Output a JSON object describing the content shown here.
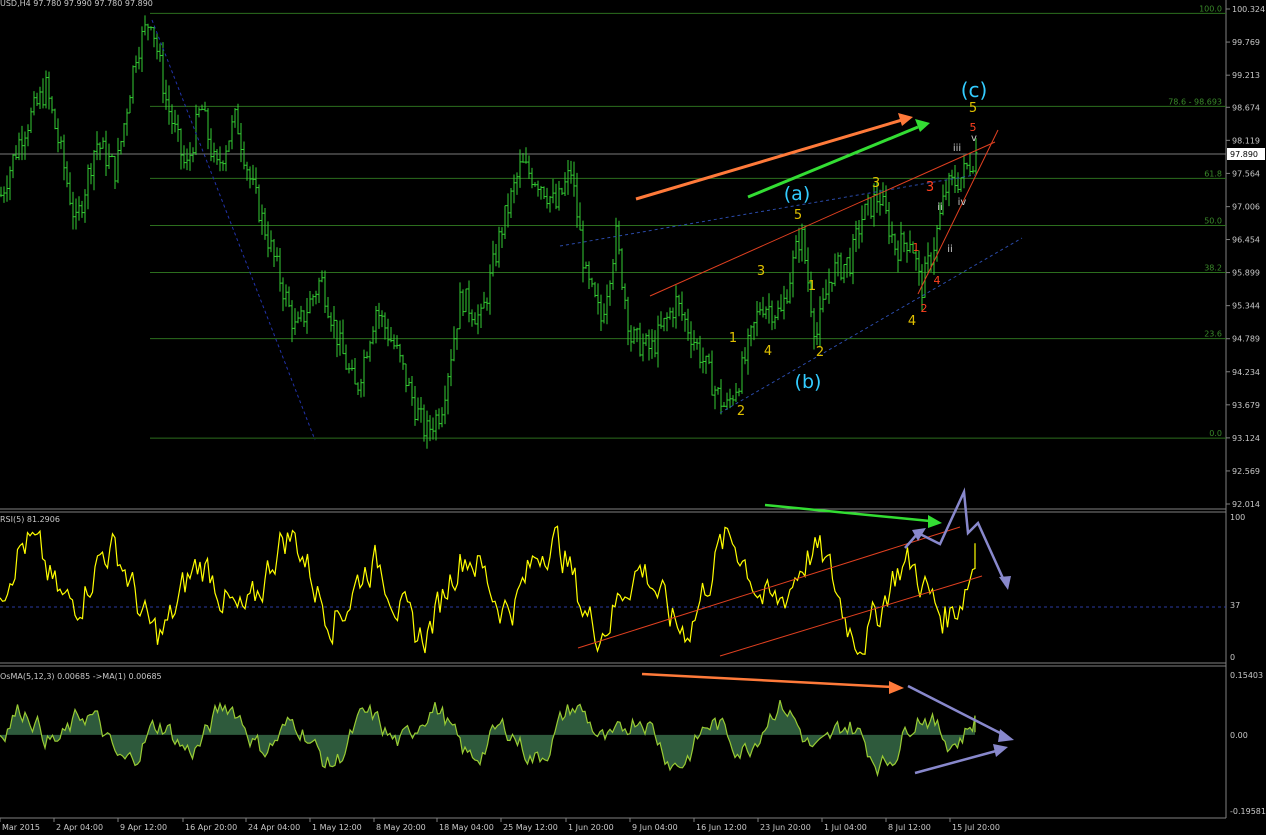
{
  "header": {
    "symbol_info": "USD,H4  97.780 97.990 97.780 97.890"
  },
  "chart_data": [
    {
      "type": "ohlc",
      "panel": "main",
      "title": "USD,H4  97.780 97.990 97.780 97.890",
      "bar_color": "#33cc33",
      "y_ticks": [
        "100.324",
        "99.769",
        "99.213",
        "98.674",
        "98.119",
        "97.564",
        "97.006",
        "96.454",
        "95.899",
        "95.344",
        "94.789",
        "94.234",
        "93.679",
        "93.124",
        "92.569",
        "92.014"
      ],
      "ylim": [
        92.014,
        100.324
      ],
      "current_price": "97.890",
      "fib_levels": [
        {
          "label": "100.0",
          "value": 100.25
        },
        {
          "label": "78.6 - 98.693",
          "value": 98.69
        },
        {
          "label": "",
          "value": 97.89
        },
        {
          "label": "61.8",
          "value": 97.48
        },
        {
          "label": "50.0",
          "value": 96.69
        },
        {
          "label": "38.2",
          "value": 95.9
        },
        {
          "label": "23.6",
          "value": 94.79
        },
        {
          "label": "0.0",
          "value": 93.12
        }
      ],
      "price_path": [
        [
          0,
          97.2
        ],
        [
          20,
          98.2
        ],
        [
          45,
          99.0
        ],
        [
          60,
          97.9
        ],
        [
          75,
          96.7
        ],
        [
          95,
          98.1
        ],
        [
          115,
          97.6
        ],
        [
          135,
          99.6
        ],
        [
          150,
          100.2
        ],
        [
          165,
          98.8
        ],
        [
          185,
          97.6
        ],
        [
          200,
          98.7
        ],
        [
          215,
          97.6
        ],
        [
          235,
          98.5
        ],
        [
          250,
          97.4
        ],
        [
          270,
          96.3
        ],
        [
          295,
          94.9
        ],
        [
          320,
          95.8
        ],
        [
          340,
          94.6
        ],
        [
          355,
          93.9
        ],
        [
          375,
          95.3
        ],
        [
          395,
          94.6
        ],
        [
          415,
          93.6
        ],
        [
          425,
          93.2
        ],
        [
          440,
          93.6
        ],
        [
          460,
          95.5
        ],
        [
          480,
          95.1
        ],
        [
          500,
          96.6
        ],
        [
          520,
          97.7
        ],
        [
          540,
          97.4
        ],
        [
          555,
          97.0
        ],
        [
          570,
          97.6
        ],
        [
          585,
          95.8
        ],
        [
          600,
          95.1
        ],
        [
          615,
          96.5
        ],
        [
          630,
          94.8
        ],
        [
          650,
          94.6
        ],
        [
          675,
          95.4
        ],
        [
          695,
          94.7
        ],
        [
          715,
          93.9
        ],
        [
          725,
          93.6
        ],
        [
          740,
          94.2
        ],
        [
          760,
          95.4
        ],
        [
          780,
          95.2
        ],
        [
          800,
          96.6
        ],
        [
          815,
          94.8
        ],
        [
          830,
          95.9
        ],
        [
          850,
          96.1
        ],
        [
          860,
          96.8
        ],
        [
          878,
          97.2
        ],
        [
          895,
          96.3
        ],
        [
          910,
          96.5
        ],
        [
          920,
          95.6
        ],
        [
          935,
          96.5
        ],
        [
          945,
          97.3
        ],
        [
          960,
          97.5
        ],
        [
          975,
          97.9
        ]
      ],
      "waves": [
        {
          "text": "(c)",
          "color": "#33ccff"
        },
        {
          "text": "(a)",
          "color": "#33ccff"
        },
        {
          "text": "(b)",
          "color": "#33ccff"
        },
        {
          "text": "5",
          "color": "#e0c000"
        },
        {
          "text": "5",
          "color": "#ff4020"
        },
        {
          "text": "3",
          "color": "#e0c000"
        },
        {
          "text": "3",
          "color": "#ff4020"
        },
        {
          "text": "5",
          "color": "#e0c000"
        },
        {
          "text": "3",
          "color": "#e0c000"
        },
        {
          "text": "1",
          "color": "#e0c000"
        },
        {
          "text": "1",
          "color": "#e0c000"
        },
        {
          "text": "4",
          "color": "#e0c000"
        },
        {
          "text": "2",
          "color": "#e0c000"
        },
        {
          "text": "2",
          "color": "#e0c000"
        },
        {
          "text": "4",
          "color": "#e0c000"
        },
        {
          "text": "4",
          "color": "#ff4020"
        },
        {
          "text": "2",
          "color": "#ff4020"
        },
        {
          "text": "1",
          "color": "#ff4020"
        },
        {
          "text": "iii",
          "color": "#c8c8c8"
        },
        {
          "text": "v",
          "color": "#c8c8c8"
        },
        {
          "text": "iv",
          "color": "#c8c8c8"
        },
        {
          "text": "ii",
          "color": "#c8c8c8"
        },
        {
          "text": "ii",
          "color": "#c8c8c8"
        }
      ]
    },
    {
      "type": "line",
      "panel": "rsi",
      "label": "RSI(5) 81.2906",
      "color": "#ffff00",
      "ylim": [
        0,
        100
      ],
      "y_ticks": [
        "100",
        "37",
        "0"
      ],
      "level": 37,
      "last_value": 81.2906
    },
    {
      "type": "area",
      "panel": "osma",
      "label": "OsMA(5,12,3) 0.00685  ->MA(1) 0.00685",
      "color": "#99cc33",
      "ylim": [
        -0.19581,
        0.15403
      ],
      "y_ticks": [
        "0.15403",
        "0.00",
        "-0.19581"
      ],
      "last_value": 0.00685
    }
  ],
  "x_axis": {
    "ticks": [
      "Mar 2015",
      "2 Apr 04:00",
      "9 Apr 12:00",
      "16 Apr 20:00",
      "24 Apr 04:00",
      "1 May 12:00",
      "8 May 20:00",
      "18 May 04:00",
      "25 May 12:00",
      "1 Jun 20:00",
      "9 Jun 04:00",
      "16 Jun 12:00",
      "23 Jun 20:00",
      "1 Jul 04:00",
      "8 Jul 12:00",
      "15 Jul 20:00"
    ]
  },
  "panels": {
    "rsi_label": "RSI(5) 81.2906",
    "osma_label": "OsMA(5,12,3) 0.00685  ->MA(1) 0.00685"
  }
}
